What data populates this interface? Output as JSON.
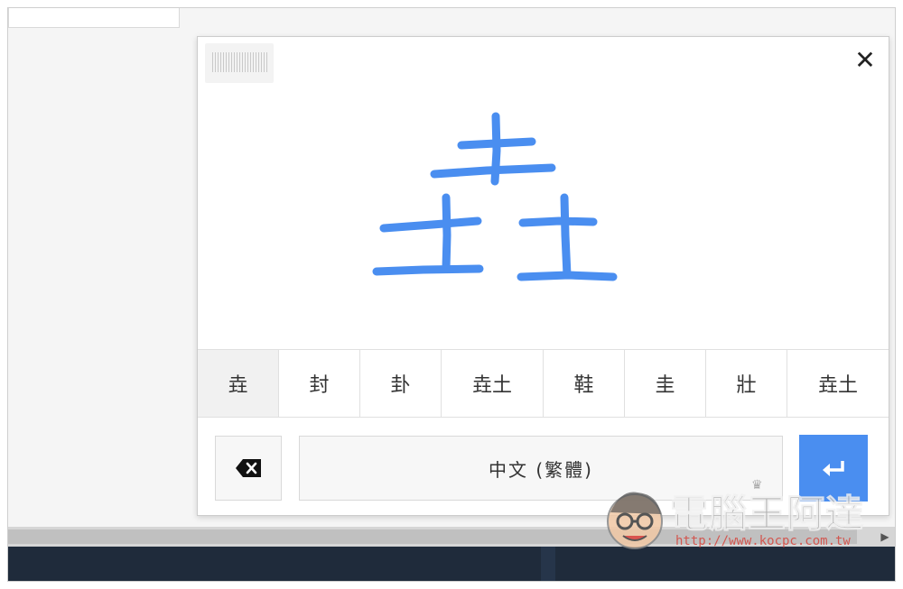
{
  "ime": {
    "candidates": [
      {
        "label": "垚",
        "selected": true
      },
      {
        "label": "封",
        "selected": false
      },
      {
        "label": "卦",
        "selected": false
      },
      {
        "label": "垚土",
        "selected": false
      },
      {
        "label": "鞋",
        "selected": false
      },
      {
        "label": "圭",
        "selected": false
      },
      {
        "label": "壯",
        "selected": false
      },
      {
        "label": "垚土",
        "selected": false
      }
    ],
    "language_label": "中文 (繁體)",
    "close_icon": "close-icon",
    "backspace_icon": "backspace-icon",
    "enter_icon": "enter-icon"
  },
  "colors": {
    "ink": "#4a8ef0",
    "enter_button": "#4a8ef0",
    "taskbar": "#1f2b3b"
  },
  "watermark": {
    "title": "電腦王阿達",
    "url": "http://www.kocpc.com.tw"
  }
}
